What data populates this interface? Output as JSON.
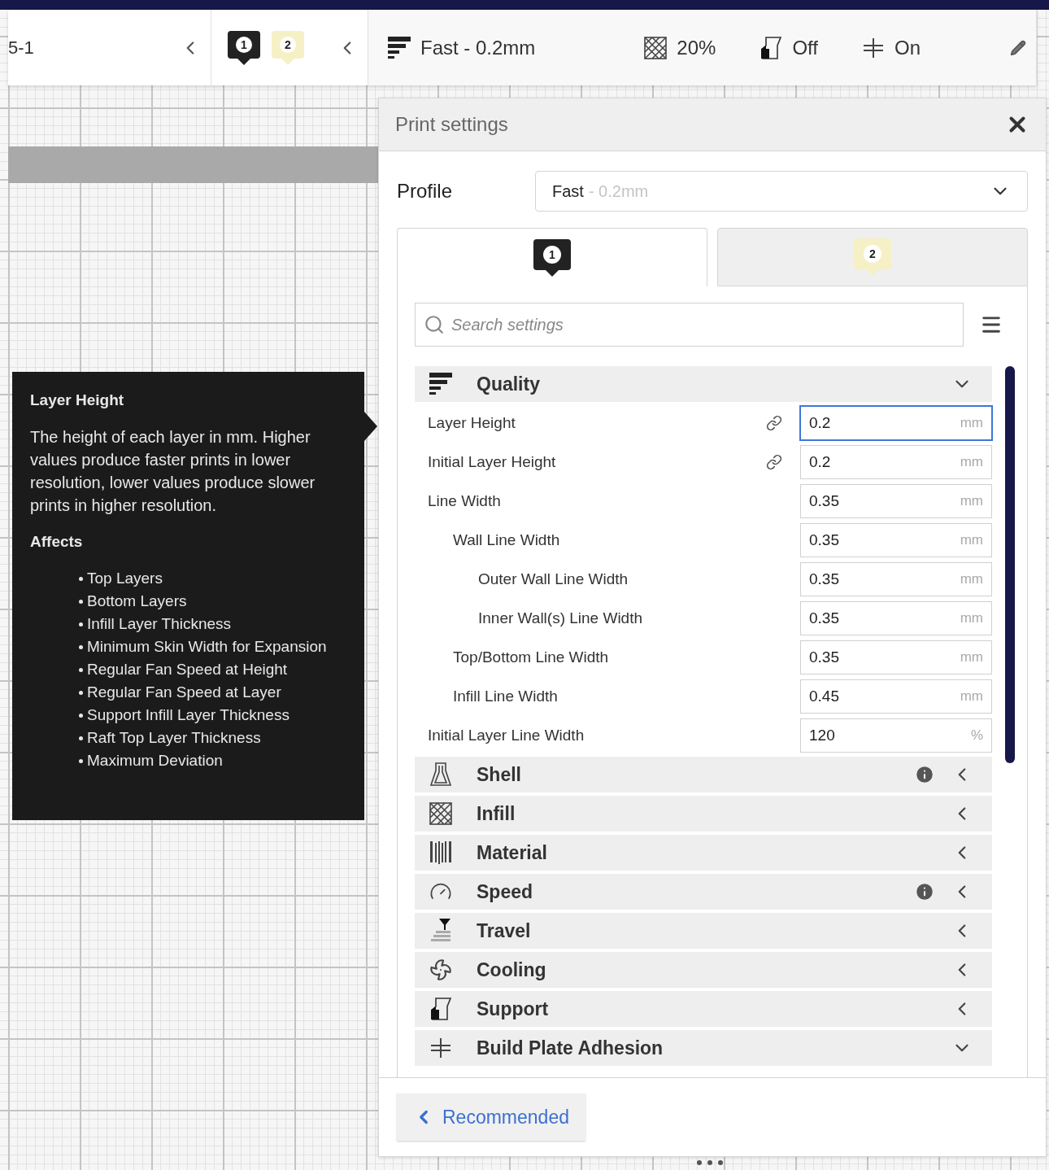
{
  "toolbar": {
    "object_label": "5-1",
    "extruders": [
      {
        "label": "1",
        "color": "#222222"
      },
      {
        "label": "2",
        "color": "#f6f0c6"
      }
    ],
    "summary": [
      {
        "kind": "profile",
        "text": "Fast - 0.2mm"
      },
      {
        "kind": "infill",
        "text": "20%"
      },
      {
        "kind": "support",
        "text": "Off"
      },
      {
        "kind": "adhesion",
        "text": "On"
      }
    ]
  },
  "panel": {
    "title": "Print settings",
    "profile_label": "Profile",
    "profile": {
      "name": "Fast",
      "detail": "- 0.2mm"
    },
    "extruder_tabs": [
      {
        "label": "1",
        "color": "#222222",
        "selected": true
      },
      {
        "label": "2",
        "color": "#f6f0c6",
        "selected": false
      }
    ],
    "search": {
      "placeholder": "Search settings"
    },
    "categories": [
      {
        "kind": "quality",
        "name": "Quality",
        "expanded": true,
        "info": false,
        "settings": [
          {
            "label": "Layer Height",
            "value": "0.2",
            "unit": "mm",
            "linked": true,
            "focused": true
          },
          {
            "label": "Initial Layer Height",
            "value": "0.2",
            "unit": "mm",
            "linked": true,
            "focused": false
          },
          {
            "label": "Line Width",
            "value": "0.35",
            "unit": "mm",
            "linked": false,
            "focused": false,
            "children": [
              {
                "label": "Wall Line Width",
                "value": "0.35",
                "unit": "mm",
                "linked": false,
                "focused": false,
                "children": [
                  {
                    "label": "Outer Wall Line Width",
                    "value": "0.35",
                    "unit": "mm",
                    "linked": false,
                    "focused": false
                  },
                  {
                    "label": "Inner Wall(s) Line Width",
                    "value": "0.35",
                    "unit": "mm",
                    "linked": false,
                    "focused": false
                  }
                ]
              },
              {
                "label": "Top/Bottom Line Width",
                "value": "0.35",
                "unit": "mm",
                "linked": false,
                "focused": false
              },
              {
                "label": "Infill Line Width",
                "value": "0.45",
                "unit": "mm",
                "linked": false,
                "focused": false
              }
            ]
          },
          {
            "label": "Initial Layer Line Width",
            "value": "120",
            "unit": "%",
            "linked": false,
            "focused": false
          }
        ]
      },
      {
        "kind": "shell",
        "name": "Shell",
        "expanded": false,
        "info": true
      },
      {
        "kind": "infill",
        "name": "Infill",
        "expanded": false,
        "info": false
      },
      {
        "kind": "material",
        "name": "Material",
        "expanded": false,
        "info": false
      },
      {
        "kind": "speed",
        "name": "Speed",
        "expanded": false,
        "info": true
      },
      {
        "kind": "travel",
        "name": "Travel",
        "expanded": false,
        "info": false
      },
      {
        "kind": "cooling",
        "name": "Cooling",
        "expanded": false,
        "info": false
      },
      {
        "kind": "support",
        "name": "Support",
        "expanded": false,
        "info": false
      },
      {
        "kind": "adhesion",
        "name": "Build Plate Adhesion",
        "expanded": true,
        "info": false
      }
    ],
    "footer_button": "Recommended"
  },
  "tooltip": {
    "title": "Layer Height",
    "description": "The height of each layer in mm. Higher values produce faster prints in lower resolution, lower values produce slower prints in higher resolution.",
    "affects_heading": "Affects",
    "affects": [
      "Top Layers",
      "Bottom Layers",
      "Infill Layer Thickness",
      "Minimum Skin Width for Expansion",
      "Regular Fan Speed at Height",
      "Regular Fan Speed at Layer",
      "Support Infill Layer Thickness",
      "Raft Top Layer Thickness",
      "Maximum Deviation"
    ]
  }
}
